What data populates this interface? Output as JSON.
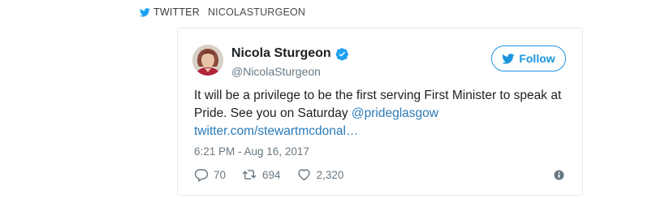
{
  "source": {
    "platform": "TWITTER",
    "handle": "NICOLASTURGEON"
  },
  "tweet": {
    "display_name": "Nicola Sturgeon",
    "username": "@NicolaSturgeon",
    "verified": true,
    "follow_label": "Follow",
    "text_before_mention": "It will be a privilege to be the first serving First Minister to speak at Pride. See you on Saturday ",
    "mention": "@prideglasgow",
    "link": "twitter.com/stewartmcdonal…",
    "timestamp": "6:21 PM - Aug 16, 2017",
    "reply_count": "70",
    "retweet_count": "694",
    "like_count": "2,320"
  },
  "icons": {
    "source": "twitter-bird-icon",
    "verified": "verified-badge-icon",
    "follow": "twitter-bird-icon",
    "reply": "reply-icon",
    "retweet": "retweet-icon",
    "like": "heart-icon",
    "info": "info-icon"
  },
  "colors": {
    "brand_blue": "#1b95e0",
    "link_blue": "#2b7bb9",
    "text": "#1c2022",
    "muted": "#697882",
    "border": "#e1e8ed"
  }
}
